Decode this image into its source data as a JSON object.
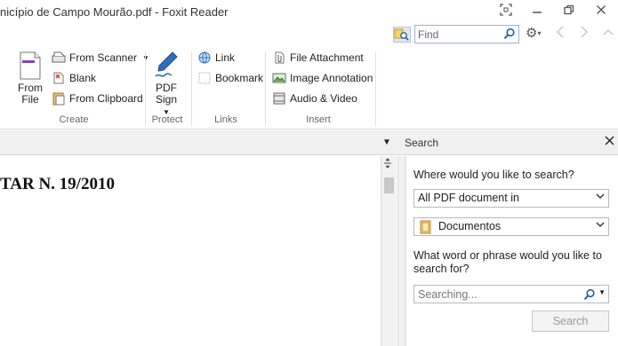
{
  "window": {
    "title": "nicípio de Campo Mourão.pdf - Foxit Reader"
  },
  "find": {
    "placeholder": "Find"
  },
  "ribbon": {
    "create": {
      "label": "Create",
      "from_file": [
        "From",
        "File"
      ],
      "from_scanner": "From Scanner",
      "blank": "Blank",
      "from_clipboard": "From Clipboard"
    },
    "protect": {
      "label": "Protect",
      "pdf_sign": [
        "PDF",
        "Sign"
      ]
    },
    "links": {
      "label": "Links",
      "link": "Link",
      "bookmark": "Bookmark"
    },
    "insert": {
      "label": "Insert",
      "file_attachment": "File Attachment",
      "image_annotation": "Image Annotation",
      "audio_video": "Audio & Video"
    }
  },
  "pane": {
    "title": "Search"
  },
  "document": {
    "visible_text": "TAR N. 19/2010"
  },
  "search_panel": {
    "where_label": "Where would you like to search?",
    "scope_value": "All PDF document in",
    "folder_value": "Documentos",
    "what_label_line1": "What word or phrase would you like to",
    "what_label_line2": "search for?",
    "search_placeholder": "Searching...",
    "search_button": "Search"
  },
  "colors": {
    "annotation_arrow": "#e8242a",
    "accent": "#2c6fbe"
  }
}
